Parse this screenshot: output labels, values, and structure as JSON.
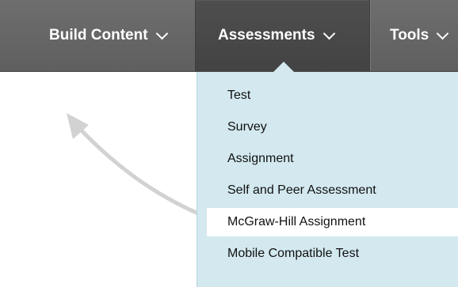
{
  "toolbar": {
    "build_content_label": "Build Content",
    "assessments_label": "Assessments",
    "tools_label": "Tools"
  },
  "assessments_menu": {
    "items": [
      {
        "label": "Test"
      },
      {
        "label": "Survey"
      },
      {
        "label": "Assignment"
      },
      {
        "label": "Self and Peer Assessment"
      },
      {
        "label": "McGraw-Hill Assignment"
      },
      {
        "label": "Mobile Compatible Test"
      }
    ],
    "highlighted_item": "McGraw-Hill Assignment"
  },
  "colors": {
    "toolbar_bg": "#666666",
    "active_tab_bg": "#474747",
    "menu_bg": "#d3e9ef",
    "highlight_bg": "#ffffff",
    "arrow": "#d2d2d2"
  },
  "icons": {
    "dropdown": "chevron-down-icon",
    "pointer": "curved-arrow-icon"
  }
}
